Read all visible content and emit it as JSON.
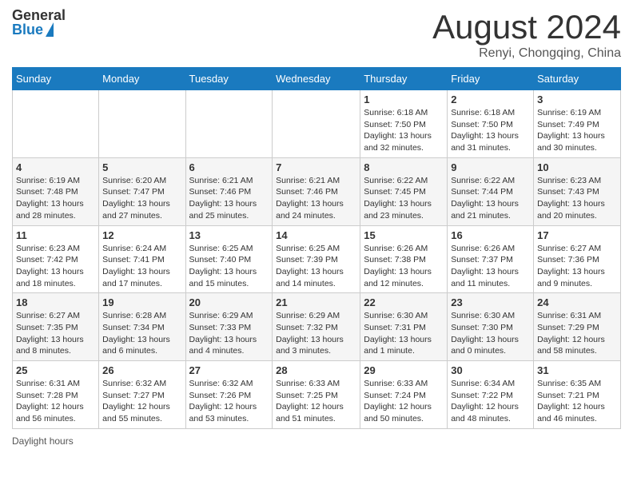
{
  "header": {
    "logo_general": "General",
    "logo_blue": "Blue",
    "month_year": "August 2024",
    "location": "Renyi, Chongqing, China"
  },
  "days_of_week": [
    "Sunday",
    "Monday",
    "Tuesday",
    "Wednesday",
    "Thursday",
    "Friday",
    "Saturday"
  ],
  "weeks": [
    [
      {
        "day": "",
        "info": ""
      },
      {
        "day": "",
        "info": ""
      },
      {
        "day": "",
        "info": ""
      },
      {
        "day": "",
        "info": ""
      },
      {
        "day": "1",
        "info": "Sunrise: 6:18 AM\nSunset: 7:50 PM\nDaylight: 13 hours and 32 minutes."
      },
      {
        "day": "2",
        "info": "Sunrise: 6:18 AM\nSunset: 7:50 PM\nDaylight: 13 hours and 31 minutes."
      },
      {
        "day": "3",
        "info": "Sunrise: 6:19 AM\nSunset: 7:49 PM\nDaylight: 13 hours and 30 minutes."
      }
    ],
    [
      {
        "day": "4",
        "info": "Sunrise: 6:19 AM\nSunset: 7:48 PM\nDaylight: 13 hours and 28 minutes."
      },
      {
        "day": "5",
        "info": "Sunrise: 6:20 AM\nSunset: 7:47 PM\nDaylight: 13 hours and 27 minutes."
      },
      {
        "day": "6",
        "info": "Sunrise: 6:21 AM\nSunset: 7:46 PM\nDaylight: 13 hours and 25 minutes."
      },
      {
        "day": "7",
        "info": "Sunrise: 6:21 AM\nSunset: 7:46 PM\nDaylight: 13 hours and 24 minutes."
      },
      {
        "day": "8",
        "info": "Sunrise: 6:22 AM\nSunset: 7:45 PM\nDaylight: 13 hours and 23 minutes."
      },
      {
        "day": "9",
        "info": "Sunrise: 6:22 AM\nSunset: 7:44 PM\nDaylight: 13 hours and 21 minutes."
      },
      {
        "day": "10",
        "info": "Sunrise: 6:23 AM\nSunset: 7:43 PM\nDaylight: 13 hours and 20 minutes."
      }
    ],
    [
      {
        "day": "11",
        "info": "Sunrise: 6:23 AM\nSunset: 7:42 PM\nDaylight: 13 hours and 18 minutes."
      },
      {
        "day": "12",
        "info": "Sunrise: 6:24 AM\nSunset: 7:41 PM\nDaylight: 13 hours and 17 minutes."
      },
      {
        "day": "13",
        "info": "Sunrise: 6:25 AM\nSunset: 7:40 PM\nDaylight: 13 hours and 15 minutes."
      },
      {
        "day": "14",
        "info": "Sunrise: 6:25 AM\nSunset: 7:39 PM\nDaylight: 13 hours and 14 minutes."
      },
      {
        "day": "15",
        "info": "Sunrise: 6:26 AM\nSunset: 7:38 PM\nDaylight: 13 hours and 12 minutes."
      },
      {
        "day": "16",
        "info": "Sunrise: 6:26 AM\nSunset: 7:37 PM\nDaylight: 13 hours and 11 minutes."
      },
      {
        "day": "17",
        "info": "Sunrise: 6:27 AM\nSunset: 7:36 PM\nDaylight: 13 hours and 9 minutes."
      }
    ],
    [
      {
        "day": "18",
        "info": "Sunrise: 6:27 AM\nSunset: 7:35 PM\nDaylight: 13 hours and 8 minutes."
      },
      {
        "day": "19",
        "info": "Sunrise: 6:28 AM\nSunset: 7:34 PM\nDaylight: 13 hours and 6 minutes."
      },
      {
        "day": "20",
        "info": "Sunrise: 6:29 AM\nSunset: 7:33 PM\nDaylight: 13 hours and 4 minutes."
      },
      {
        "day": "21",
        "info": "Sunrise: 6:29 AM\nSunset: 7:32 PM\nDaylight: 13 hours and 3 minutes."
      },
      {
        "day": "22",
        "info": "Sunrise: 6:30 AM\nSunset: 7:31 PM\nDaylight: 13 hours and 1 minute."
      },
      {
        "day": "23",
        "info": "Sunrise: 6:30 AM\nSunset: 7:30 PM\nDaylight: 13 hours and 0 minutes."
      },
      {
        "day": "24",
        "info": "Sunrise: 6:31 AM\nSunset: 7:29 PM\nDaylight: 12 hours and 58 minutes."
      }
    ],
    [
      {
        "day": "25",
        "info": "Sunrise: 6:31 AM\nSunset: 7:28 PM\nDaylight: 12 hours and 56 minutes."
      },
      {
        "day": "26",
        "info": "Sunrise: 6:32 AM\nSunset: 7:27 PM\nDaylight: 12 hours and 55 minutes."
      },
      {
        "day": "27",
        "info": "Sunrise: 6:32 AM\nSunset: 7:26 PM\nDaylight: 12 hours and 53 minutes."
      },
      {
        "day": "28",
        "info": "Sunrise: 6:33 AM\nSunset: 7:25 PM\nDaylight: 12 hours and 51 minutes."
      },
      {
        "day": "29",
        "info": "Sunrise: 6:33 AM\nSunset: 7:24 PM\nDaylight: 12 hours and 50 minutes."
      },
      {
        "day": "30",
        "info": "Sunrise: 6:34 AM\nSunset: 7:22 PM\nDaylight: 12 hours and 48 minutes."
      },
      {
        "day": "31",
        "info": "Sunrise: 6:35 AM\nSunset: 7:21 PM\nDaylight: 12 hours and 46 minutes."
      }
    ]
  ],
  "footer": {
    "daylight_label": "Daylight hours"
  }
}
